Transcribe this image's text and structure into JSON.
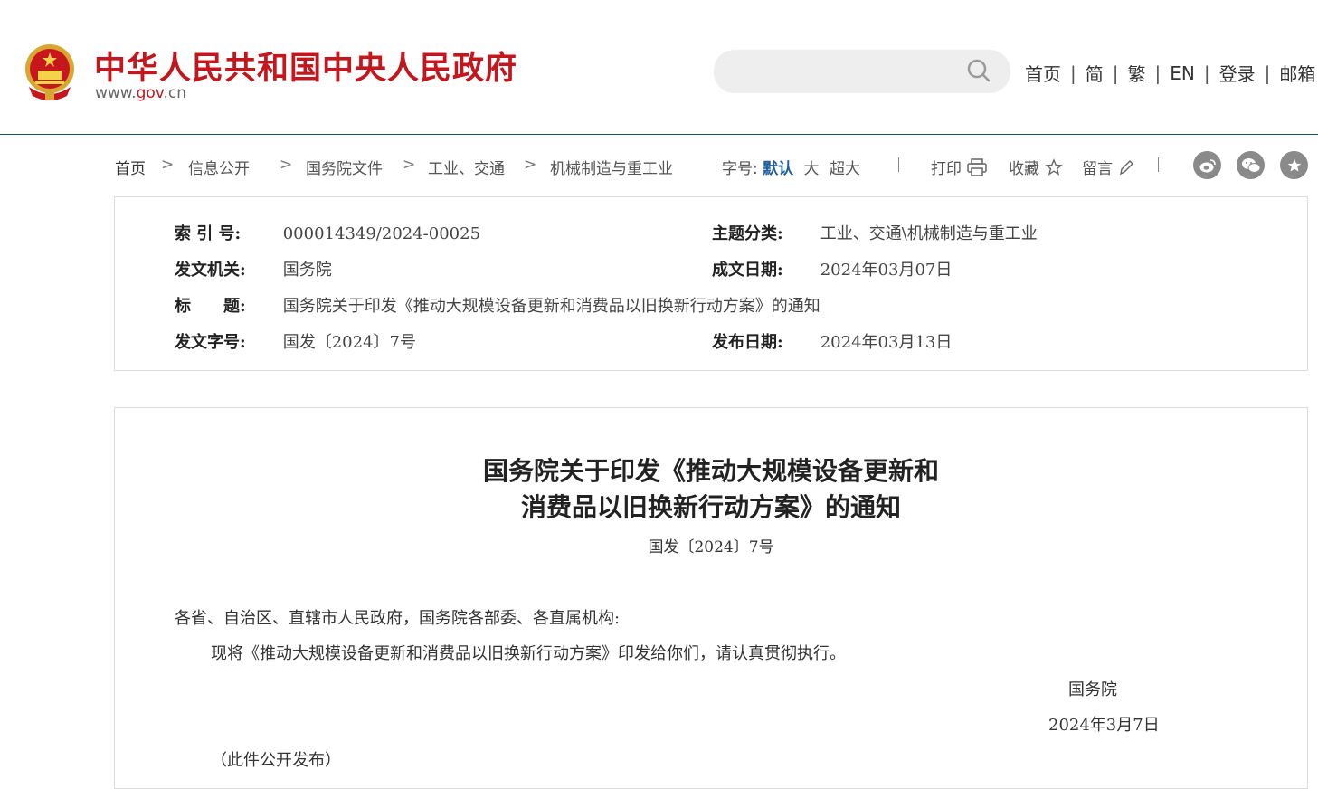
{
  "header": {
    "site_title": "中华人民共和国中央人民政府",
    "site_url": "www.gov.cn",
    "search_placeholder": "",
    "nav": [
      "首页",
      "简",
      "繁",
      "EN",
      "登录",
      "邮箱"
    ]
  },
  "breadcrumb": [
    "首页",
    "信息公开",
    "国务院文件",
    "工业、交通",
    "机械制造与重工业"
  ],
  "font_size": {
    "label": "字号:",
    "options": [
      "默认",
      "大",
      "超大"
    ],
    "selected": "默认"
  },
  "tools": {
    "print": "打印",
    "favorite": "收藏",
    "comment": "留言"
  },
  "share_icons": [
    "weibo-icon",
    "wechat-icon",
    "star-share-icon"
  ],
  "meta": {
    "index_label": "索 引 号:",
    "index_value": "000014349/2024-00025",
    "topic_label": "主题分类:",
    "topic_value": "工业、交通\\机械制造与重工业",
    "issuer_label": "发文机关:",
    "issuer_value": "国务院",
    "written_date_label": "成文日期:",
    "written_date_value": "2024年03月07日",
    "title_label": "标　　题:",
    "title_value": "国务院关于印发《推动大规模设备更新和消费品以旧换新行动方案》的通知",
    "doc_no_label": "发文字号:",
    "doc_no_value": "国发〔2024〕7号",
    "publish_date_label": "发布日期:",
    "publish_date_value": "2024年03月13日"
  },
  "article": {
    "title_line1": "国务院关于印发《推动大规模设备更新和",
    "title_line2": "消费品以旧换新行动方案》的通知",
    "doc_number": "国发〔2024〕7号",
    "salutation": "各省、自治区、直辖市人民政府，国务院各部委、各直属机构:",
    "body": "现将《推动大规模设备更新和消费品以旧换新行动方案》印发给你们，请认真贯彻执行。",
    "signature": "国务院",
    "date": "2024年3月7日",
    "note": "（此件公开发布）"
  },
  "colors": {
    "brand_red": "#c4161c",
    "active_blue": "#1d5e9c",
    "rule": "#1f4f6f"
  }
}
